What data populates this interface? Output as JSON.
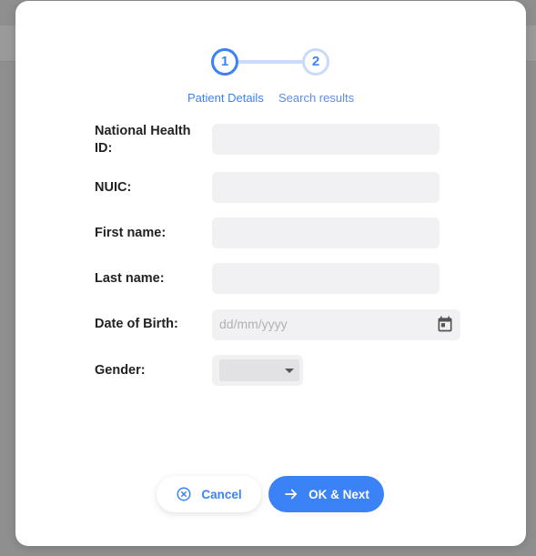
{
  "stepper": {
    "steps": [
      {
        "number": "1",
        "label": "Patient Details",
        "active": true
      },
      {
        "number": "2",
        "label": "Search results",
        "active": false
      }
    ]
  },
  "form": {
    "national_health_id_label": "National Health ID:",
    "nuic_label": "NUIC:",
    "first_name_label": "First name:",
    "last_name_label": "Last name:",
    "dob_label": "Date of Birth:",
    "dob_placeholder": "dd/mm/yyyy",
    "gender_label": "Gender:"
  },
  "buttons": {
    "cancel_label": "Cancel",
    "ok_label": "OK & Next"
  },
  "icons": {
    "cancel": "close-circle-icon",
    "ok": "arrow-right-icon",
    "calendar": "calendar-icon",
    "dropdown": "chevron-down-icon"
  },
  "colors": {
    "accent": "#3b82f6",
    "step_inactive": "#c9dbf8",
    "field_bg": "#f1f1f3",
    "overlay": "#8f8f8f"
  }
}
